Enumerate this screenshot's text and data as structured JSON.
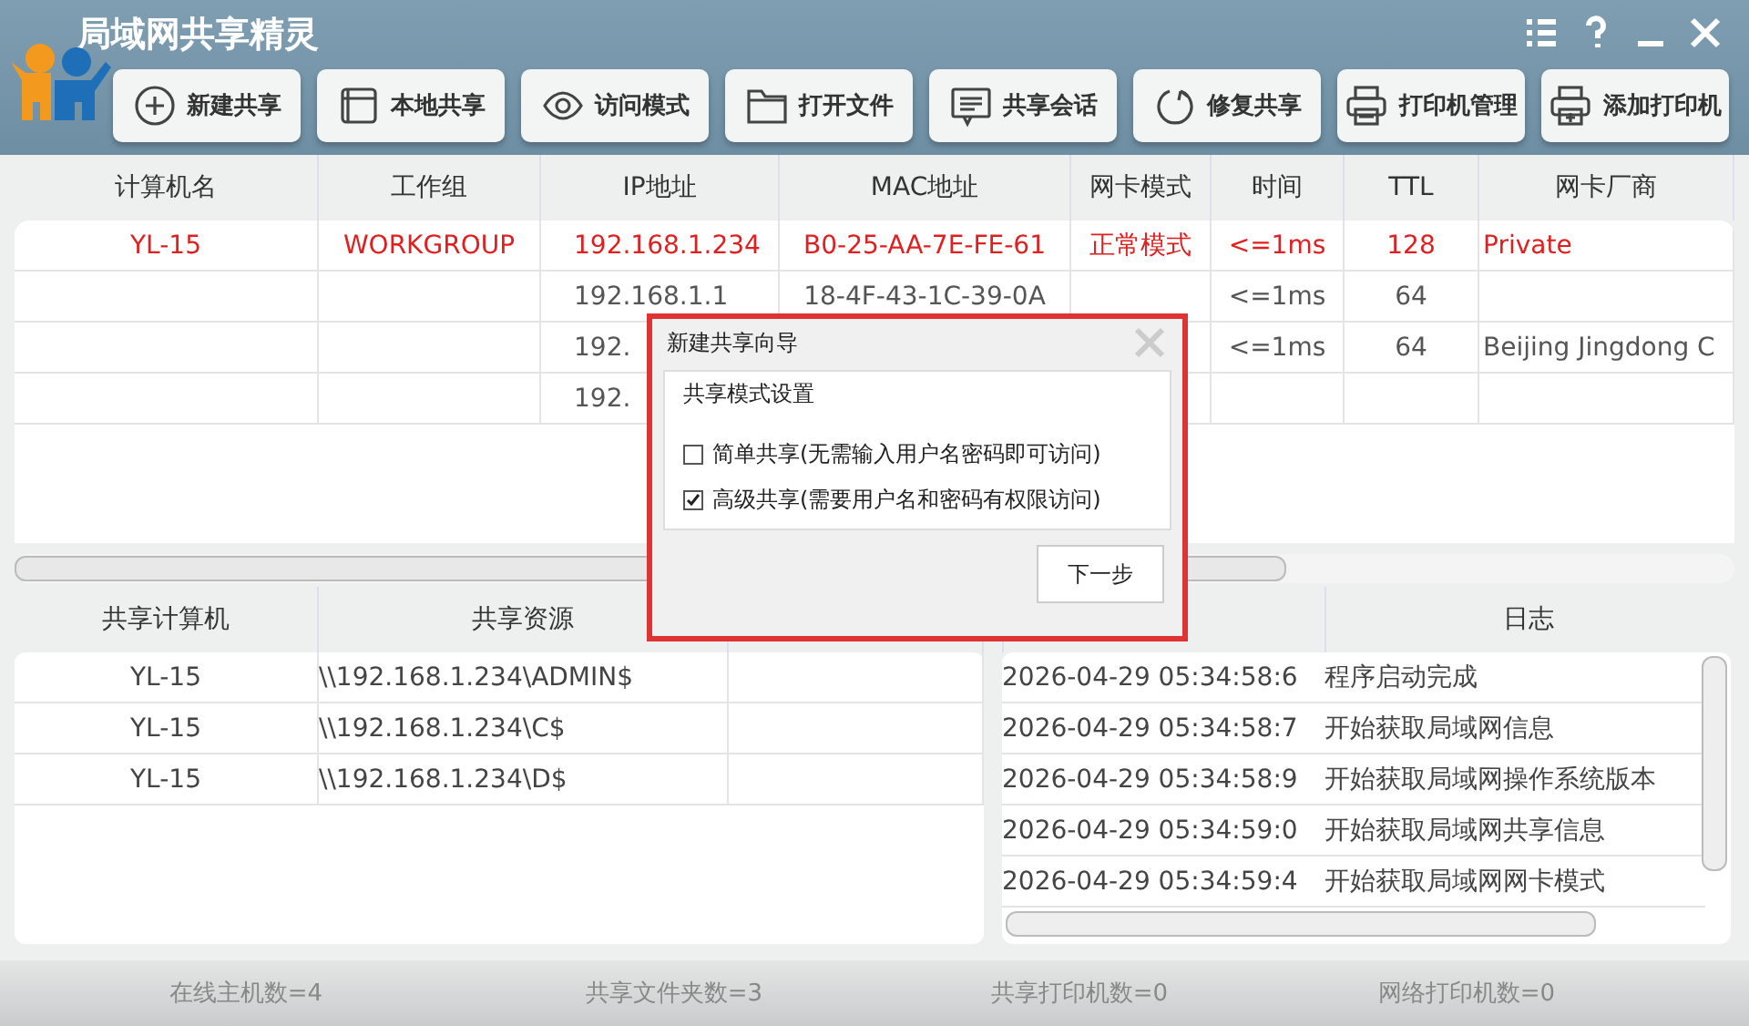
{
  "window": {
    "title": "局域网共享精灵"
  },
  "toolbar": [
    {
      "label": "新建共享",
      "kind": "plus"
    },
    {
      "label": "本地共享",
      "kind": "window"
    },
    {
      "label": "访问模式",
      "kind": "eye"
    },
    {
      "label": "打开文件",
      "kind": "folder"
    },
    {
      "label": "共享会话",
      "kind": "chat"
    },
    {
      "label": "修复共享",
      "kind": "refresh"
    },
    {
      "label": "打印机管理",
      "kind": "printer"
    },
    {
      "label": "添加打印机",
      "kind": "printer-add"
    }
  ],
  "hosts_table": {
    "columns": [
      "计算机名",
      "工作组",
      "IP地址",
      "MAC地址",
      "网卡模式",
      "时间",
      "TTL",
      "网卡厂商"
    ],
    "rows": [
      {
        "highlighted": true,
        "computer_name": "YL-15",
        "workgroup": "WORKGROUP",
        "ip": "192.168.1.234",
        "mac": "B0-25-AA-7E-FE-61",
        "nic_mode": "正常模式",
        "time": "<=1ms",
        "ttl": "128",
        "vendor": "Private"
      },
      {
        "highlighted": false,
        "ip": "192.168.1.1",
        "mac": "18-4F-43-1C-39-0A",
        "time": "<=1ms",
        "ttl": "64"
      },
      {
        "highlighted": false,
        "ip": "192.",
        "time": "<=1ms",
        "ttl": "64",
        "vendor": "Beijing Jingdong C"
      },
      {
        "highlighted": false,
        "ip": "192."
      }
    ]
  },
  "shares_table": {
    "columns": [
      "共享计算机",
      "共享资源"
    ],
    "rows": [
      {
        "computer": "YL-15",
        "resource": "\\\\192.168.1.234\\ADMIN$"
      },
      {
        "computer": "YL-15",
        "resource": "\\\\192.168.1.234\\C$"
      },
      {
        "computer": "YL-15",
        "resource": "\\\\192.168.1.234\\D$"
      }
    ]
  },
  "log": {
    "header": "日志",
    "entries": [
      {
        "time": "2026-04-29 05:34:58:6",
        "message": "程序启动完成"
      },
      {
        "time": "2026-04-29 05:34:58:7",
        "message": "开始获取局域网信息"
      },
      {
        "time": "2026-04-29 05:34:58:9",
        "message": "开始获取局域网操作系统版本"
      },
      {
        "time": "2026-04-29 05:34:59:0",
        "message": "开始获取局域网共享信息"
      },
      {
        "time": "2026-04-29 05:34:59:4",
        "message": "开始获取局域网网卡模式"
      }
    ]
  },
  "dialog": {
    "title": "新建共享向导",
    "group_title": "共享模式设置",
    "options": [
      {
        "label": "简单共享(无需输入用户名密码即可访问)",
        "checked": false
      },
      {
        "label": "高级共享(需要用户名和密码有权限访问)",
        "checked": true
      }
    ],
    "button": "下一步"
  },
  "status_bar": [
    "在线主机数=4",
    "共享文件夹数=3",
    "共享打印机数=0",
    "网络打印机数=0"
  ]
}
